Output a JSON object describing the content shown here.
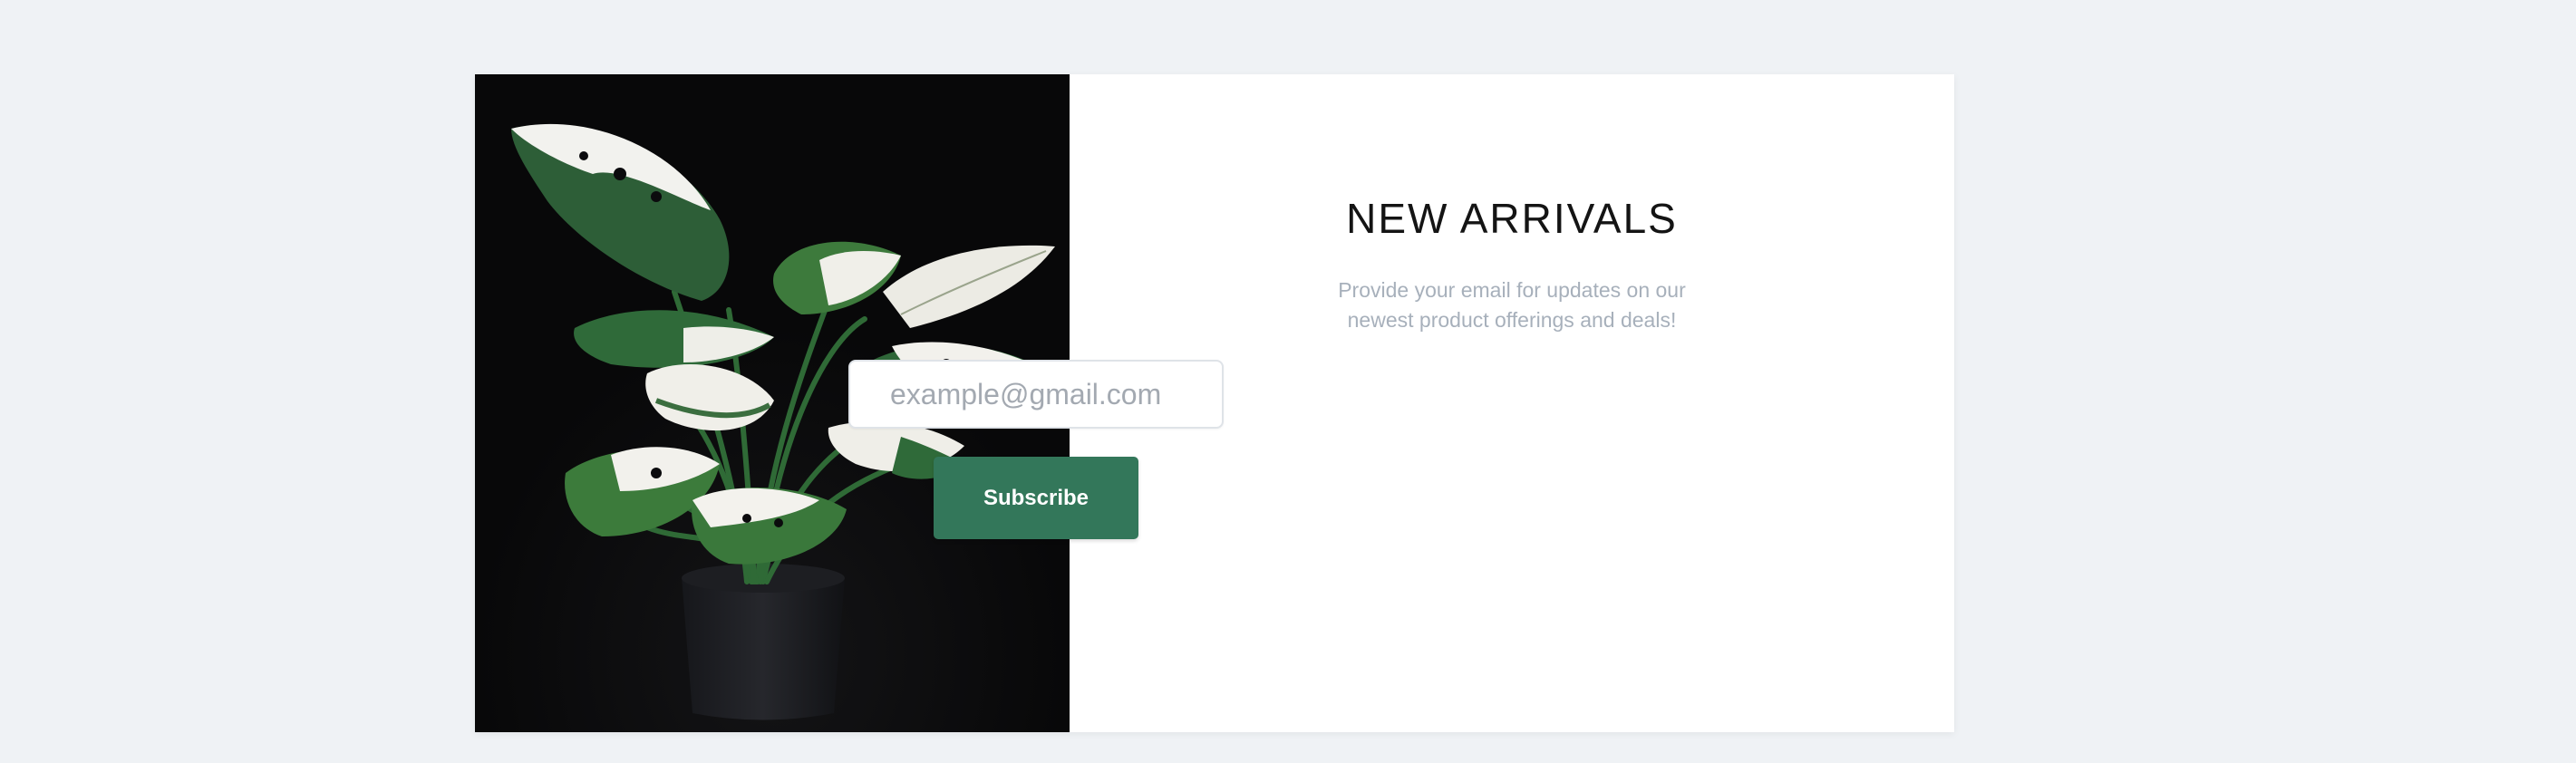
{
  "newsletter": {
    "title": "NEW ARRIVALS",
    "description": "Provide your email for updates on our newest product offerings and deals!",
    "email_placeholder": "example@gmail.com",
    "email_value": "",
    "subscribe_label": "Subscribe"
  },
  "image": {
    "subject": "variegated-monstera-plant"
  },
  "colors": {
    "page_background": "#eff2f5",
    "card_background": "#ffffff",
    "image_background": "#0b0b0d",
    "button_background": "#33775a",
    "button_text": "#ffffff",
    "title_text": "#141414",
    "description_text": "#a7b0bb"
  }
}
